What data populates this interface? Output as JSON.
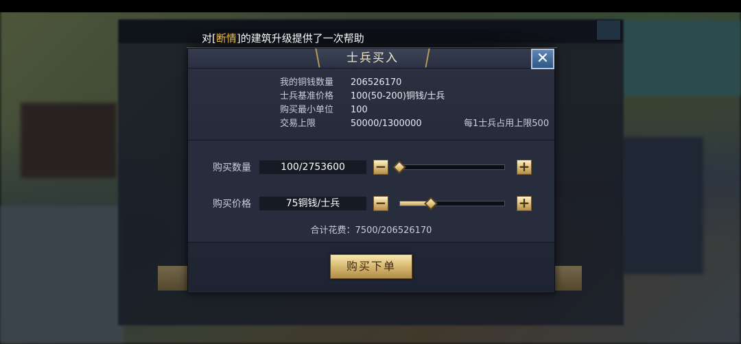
{
  "notice": {
    "prefix": "对[",
    "player_name": "断情",
    "suffix": "]的建筑升级提供了一次帮助"
  },
  "dialog": {
    "title": "士兵买入",
    "close_glyph": "✕",
    "info": [
      {
        "label": "我的铜钱数量",
        "value": "206526170",
        "note": ""
      },
      {
        "label": "士兵基准价格",
        "value": "100(50-200)铜钱/士兵",
        "note": ""
      },
      {
        "label": "购买最小单位",
        "value": "100",
        "note": ""
      },
      {
        "label": "交易上限",
        "value": "50000/1300000",
        "note": "每1士兵占用上限500"
      }
    ],
    "quantity": {
      "label": "购买数量",
      "value": "100/2753600",
      "minus": "−",
      "plus": "+",
      "slider_fraction": 0.0
    },
    "price": {
      "label": "购买价格",
      "value": "75铜钱/士兵",
      "minus": "−",
      "plus": "+",
      "slider_fraction": 0.3
    },
    "total": "合计花费：7500/206526170",
    "buy_button": "购买下单"
  }
}
